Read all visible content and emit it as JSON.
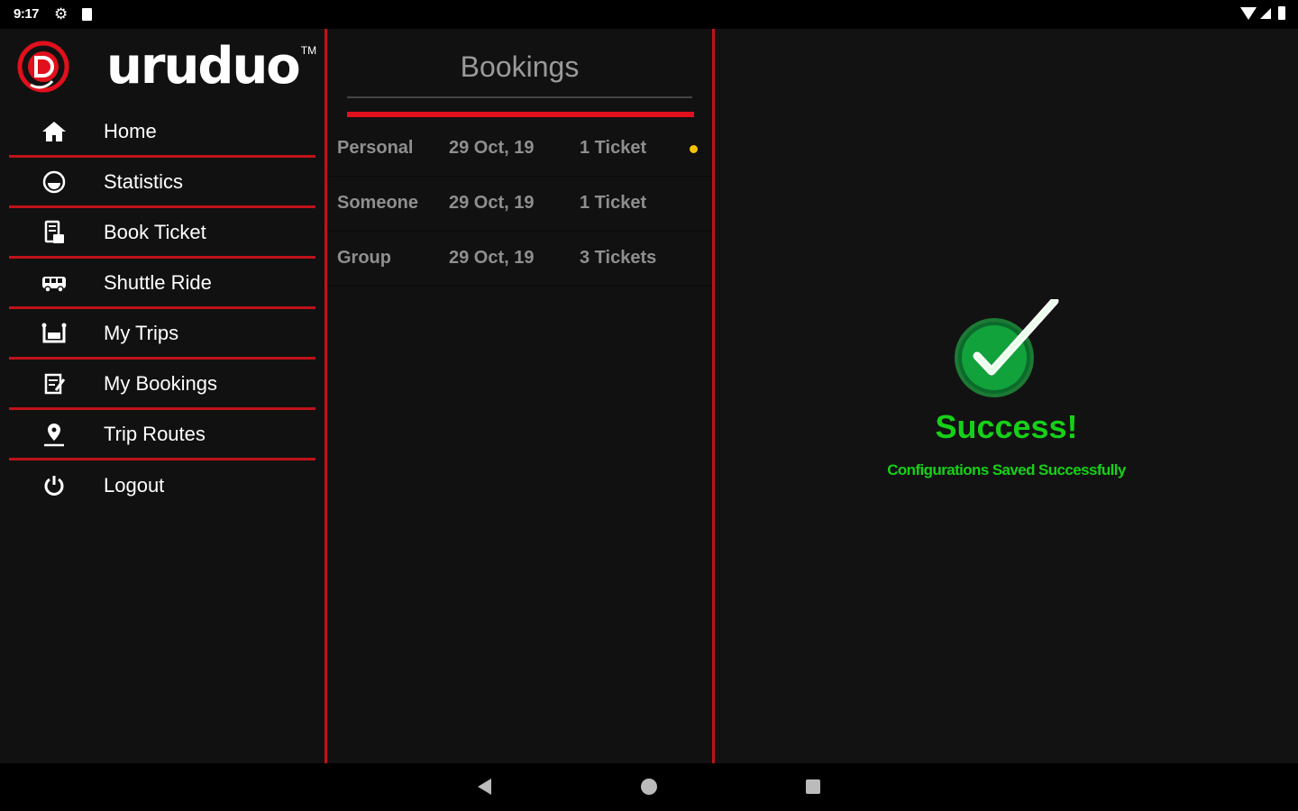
{
  "status_bar": {
    "time": "9:17"
  },
  "brand": {
    "name": "uruduo",
    "tm": "TM",
    "accent": "#e0101c"
  },
  "sidebar": {
    "items": [
      {
        "label": "Home",
        "icon": "home-icon"
      },
      {
        "label": "Statistics",
        "icon": "statistics-icon"
      },
      {
        "label": "Book Ticket",
        "icon": "book-ticket-icon"
      },
      {
        "label": "Shuttle Ride",
        "icon": "bus-icon"
      },
      {
        "label": "My Trips",
        "icon": "trips-icon"
      },
      {
        "label": "My Bookings",
        "icon": "bookings-icon"
      },
      {
        "label": "Trip Routes",
        "icon": "map-pin-icon"
      },
      {
        "label": "Logout",
        "icon": "power-icon"
      }
    ]
  },
  "bookings": {
    "title": "Bookings",
    "rows": [
      {
        "type": "Personal",
        "date": "29 Oct, 19",
        "tickets": "1 Ticket",
        "unread": true
      },
      {
        "type": "Someone",
        "date": "29 Oct, 19",
        "tickets": "1 Ticket",
        "unread": false
      },
      {
        "type": "Group",
        "date": "29 Oct, 19",
        "tickets": "3 Tickets",
        "unread": false
      }
    ]
  },
  "success": {
    "title": "Success!",
    "message": "Configurations Saved Successfully",
    "color": "#16d018"
  }
}
